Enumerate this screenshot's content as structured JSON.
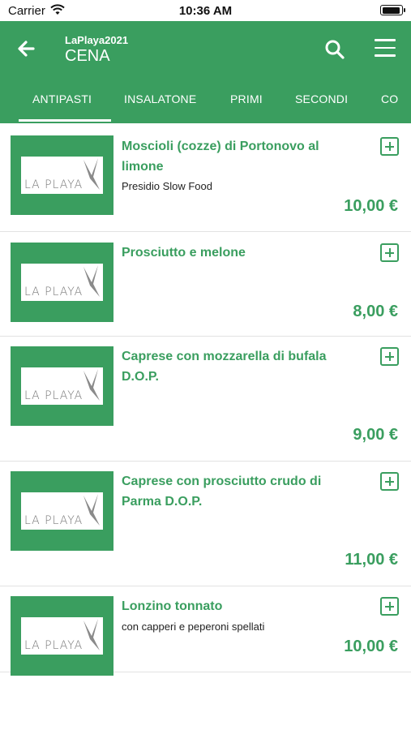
{
  "status_bar": {
    "carrier": "Carrier",
    "time": "10:36 AM"
  },
  "header": {
    "venue": "LaPlaya2021",
    "menu_name": "CENA"
  },
  "tabs": [
    "ANTIPASTI",
    "INSALATONE",
    "PRIMI",
    "SECONDI",
    "CO"
  ],
  "active_tab": "ANTIPASTI",
  "logo_text": "LA PLAYA",
  "items": [
    {
      "name": "Moscioli (cozze) di Portonovo al limone",
      "description": "Presidio Slow Food",
      "price": "10,00 €"
    },
    {
      "name": "Prosciutto e melone",
      "description": "",
      "price": "8,00 €"
    },
    {
      "name": "Caprese con mozzarella di bufala D.O.P.",
      "description": "",
      "price": "9,00 €"
    },
    {
      "name": "Caprese con prosciutto crudo di Parma D.O.P.",
      "description": "",
      "price": "11,00 €"
    },
    {
      "name": "Lonzino tonnato",
      "description": "con capperi e peperoni spellati",
      "price": "10,00 €"
    }
  ],
  "colors": {
    "primary": "#3a9e5f",
    "text": "#222222",
    "divider": "#e2e2e2"
  }
}
